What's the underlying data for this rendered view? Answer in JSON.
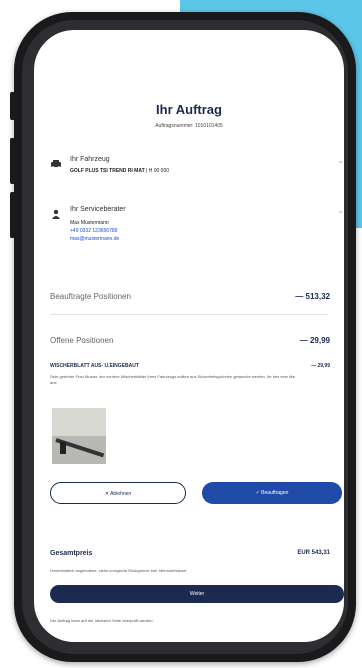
{
  "header": {
    "title": "Ihr Auftrag",
    "order_number": "Auftragsnummer: 1010101405"
  },
  "vehicle": {
    "label": "Ihr Fahrzeug",
    "model": "GOLF PLUS TSI TREND RI MAT",
    "detail": "| H 00 000"
  },
  "advisor": {
    "label": "Ihr Serviceberater",
    "name": "Max Mustermann",
    "phone": "+49 0332 123656789",
    "email": "max@mustermann.de"
  },
  "approved": {
    "label": "Beauftragte Positionen",
    "amount": "— 513,32"
  },
  "open": {
    "label": "Offene Positionen",
    "amount": "— 29,99"
  },
  "item": {
    "title": "WISCHERBLATT AUS- U.EINGEBAUT",
    "price": "— 29,99",
    "description": "Sehr geehrter Frau Muster, der vordere Wischerblätter Ihres Fahrzeugs sollten aus Sicherheitsgründen getauscht werden. Ihr bes eine ilke ane."
  },
  "buttons": {
    "decline": "✕ Ablehnen",
    "approve": "✓ Beauftragen"
  },
  "total": {
    "label": "Gesamtpreis",
    "value": "EUR 543,31",
    "note": "Unverbindlich angebotene, siehe korrigierte Rückgrenze inkl. Mehrwertsteuer"
  },
  "cta": "Weiter",
  "footer": "Der Auftrag kann auf der nächsten Seite überprüft werden.",
  "colors": {
    "accent": "#5cc6e8",
    "navy": "#1b2a4e",
    "blue": "#1f4aa8"
  }
}
